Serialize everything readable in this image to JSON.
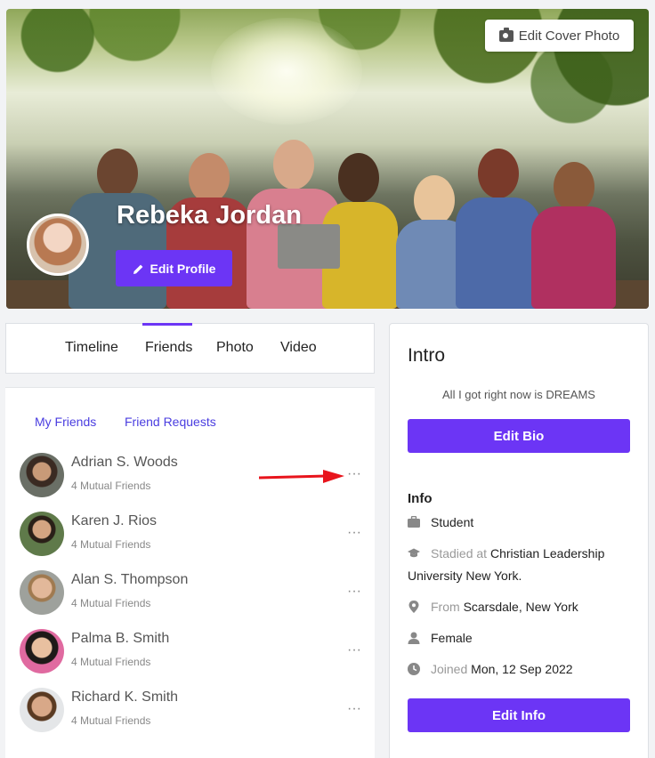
{
  "cover": {
    "edit_cover_label": "Edit Cover Photo"
  },
  "profile": {
    "name": "Rebeka Jordan",
    "edit_profile_label": "Edit Profile"
  },
  "tabs": [
    {
      "label": "Timeline",
      "active": false
    },
    {
      "label": "Friends",
      "active": true
    },
    {
      "label": "Photo",
      "active": false
    },
    {
      "label": "Video",
      "active": false
    }
  ],
  "friends_panel": {
    "sub_tabs": [
      "My Friends",
      "Friend Requests"
    ],
    "friends": [
      {
        "name": "Adrian S. Woods",
        "mutual": "4 Mutual Friends"
      },
      {
        "name": "Karen J. Rios",
        "mutual": "4 Mutual Friends"
      },
      {
        "name": "Alan S. Thompson",
        "mutual": "4 Mutual Friends"
      },
      {
        "name": "Palma B. Smith",
        "mutual": "4 Mutual Friends"
      },
      {
        "name": "Richard K. Smith",
        "mutual": "4 Mutual Friends"
      }
    ],
    "more_glyph": "···"
  },
  "intro": {
    "title": "Intro",
    "bio": "All I got right now is DREAMS",
    "edit_bio_label": "Edit Bio",
    "info_title": "Info",
    "occupation": "Student",
    "studied_prefix": "Stadied at",
    "studied_place": "Christian Leadership University New York.",
    "from_prefix": "From",
    "from_place": "Scarsdale, New York",
    "gender": "Female",
    "joined_prefix": "Joined",
    "joined_date": "Mon, 12 Sep 2022",
    "edit_info_label": "Edit Info"
  },
  "colors": {
    "accent": "#6c35f5",
    "link": "#4a3de0",
    "annotation_arrow": "#e8141c"
  }
}
